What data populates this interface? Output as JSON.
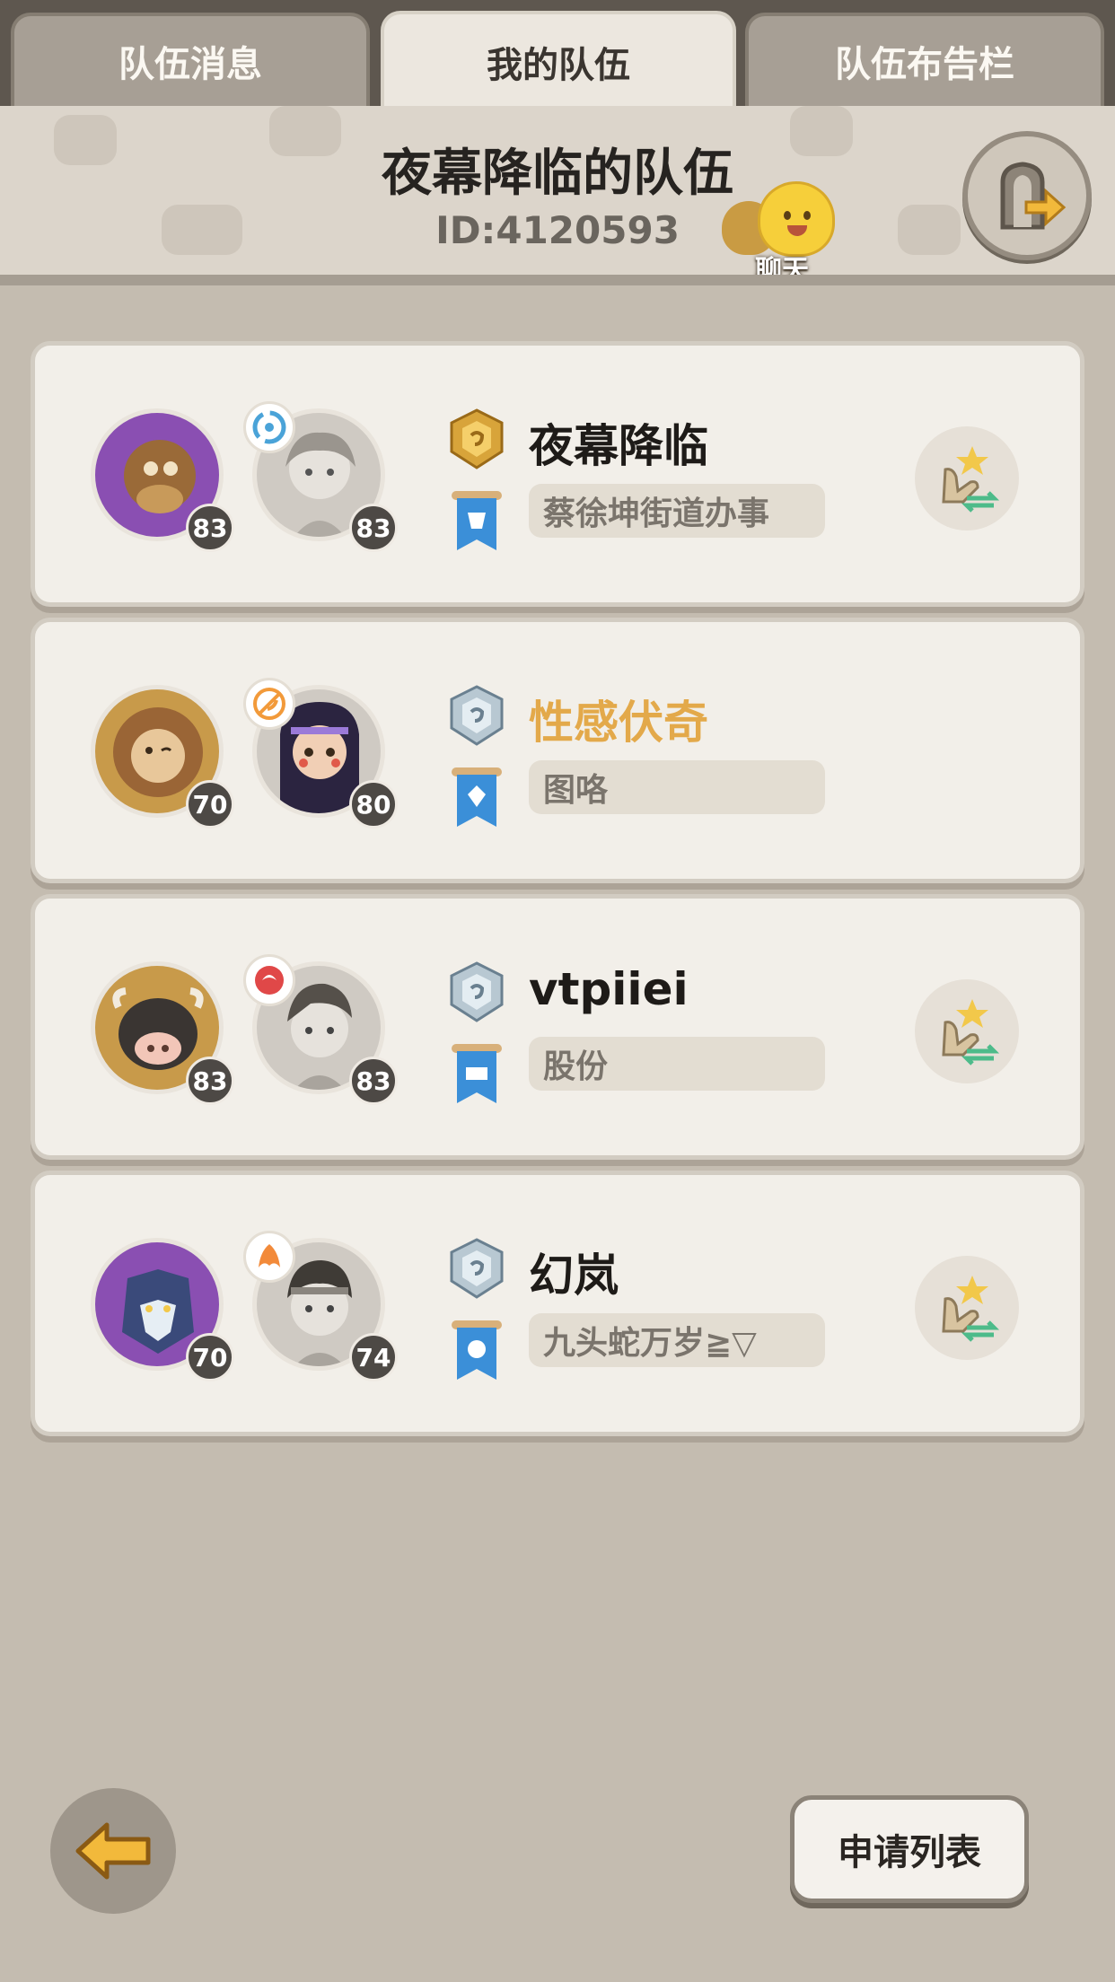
{
  "tabs": [
    {
      "label": "队伍消息",
      "active": false
    },
    {
      "label": "我的队伍",
      "active": true
    },
    {
      "label": "队伍布告栏",
      "active": false
    }
  ],
  "header": {
    "team_name": "夜幕降临的队伍",
    "team_id": "ID:4120593",
    "chat_label": "聊天",
    "exit_icon": "exit-door-icon"
  },
  "members": [
    {
      "name": "夜幕降临",
      "title": "蔡徐坤街道办事",
      "pet_level": "83",
      "char_level": "83",
      "rank": "gold",
      "element": "water",
      "name_color": "#1e1b18",
      "pet_color": "#8a4fb2",
      "swap": true
    },
    {
      "name": "性感伏奇",
      "title": "图咯",
      "pet_level": "70",
      "char_level": "80",
      "rank": "silver",
      "element": "fire",
      "name_color": "#e3a94a",
      "pet_color": "#c89a4a",
      "swap": false
    },
    {
      "name": "vtpiiei",
      "title": "股份",
      "pet_level": "83",
      "char_level": "83",
      "rank": "silver",
      "element": "dark",
      "name_color": "#1e1b18",
      "pet_color": "#c89a4a",
      "swap": true
    },
    {
      "name": "幻岚",
      "title": "九头蛇万岁≧▽",
      "pet_level": "70",
      "char_level": "74",
      "rank": "silver",
      "element": "fire",
      "name_color": "#1e1b18",
      "pet_color": "#8a4fb2",
      "swap": true
    }
  ],
  "footer": {
    "back_icon": "back-arrow-icon",
    "apply_list_label": "申请列表"
  }
}
